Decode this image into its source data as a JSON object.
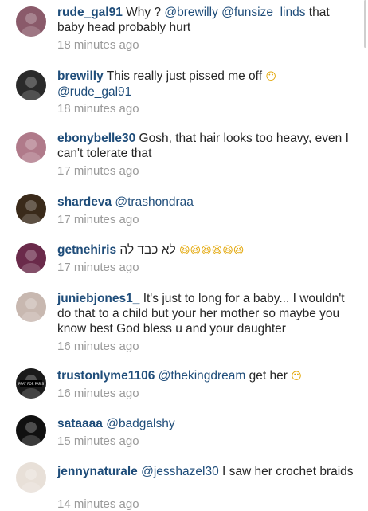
{
  "comments": [
    {
      "user": "rude_gal91",
      "segments": [
        {
          "t": "Why ? "
        },
        {
          "t": "@brewilly",
          "m": true
        },
        {
          "t": " "
        },
        {
          "t": "@funsize_linds",
          "m": true
        },
        {
          "t": " that baby head probably hurt"
        }
      ],
      "time": "18 minutes ago",
      "avatar_bg": "#8a5a6a"
    },
    {
      "user": "brewilly",
      "segments": [
        {
          "t": "This really just pissed me off "
        },
        {
          "t": "😶"
        },
        {
          "t": " "
        },
        {
          "t": "@rude_gal91",
          "m": true
        }
      ],
      "time": "18 minutes ago",
      "avatar_bg": "#2a2a2a"
    },
    {
      "user": "ebonybelle30",
      "segments": [
        {
          "t": "Gosh, that hair looks too heavy, even I can't tolerate that"
        }
      ],
      "time": "17 minutes ago",
      "avatar_bg": "#b07a8a"
    },
    {
      "user": "shardeva",
      "segments": [
        {
          "t": "@trashondraa",
          "m": true
        }
      ],
      "time": "17 minutes ago",
      "avatar_bg": "#3a2a1a"
    },
    {
      "user": "getnehiris",
      "segments": [
        {
          "t": "לא כבד לה "
        },
        {
          "t": "😆😆😆😆😆😆"
        }
      ],
      "time": "17 minutes ago",
      "avatar_bg": "#6a2a4a"
    },
    {
      "user": "juniebjones1_",
      "segments": [
        {
          "t": "It's just to long for a baby... I wouldn't do that to a child but your her mother so maybe you know best God bless u and your daughter"
        }
      ],
      "time": "16 minutes ago",
      "avatar_bg": "#c8b8b0"
    },
    {
      "user": "trustonlyme1106",
      "segments": [
        {
          "t": "@thekingdream",
          "m": true
        },
        {
          "t": " get her "
        },
        {
          "t": "😶"
        }
      ],
      "time": "16 minutes ago",
      "avatar_bg": "#1a1a1a",
      "avatar_text": "PRAY FOR PARIS"
    },
    {
      "user": "sataaaa",
      "segments": [
        {
          "t": "@badgalshy",
          "m": true
        }
      ],
      "time": "15 minutes ago",
      "avatar_bg": "#101010"
    },
    {
      "user": "jennynaturale",
      "segments": [
        {
          "t": "@jesshazel30",
          "m": true
        },
        {
          "t": " I saw her crochet braids"
        }
      ],
      "time": "14 minutes ago",
      "avatar_bg": "#e8e0d8"
    }
  ]
}
